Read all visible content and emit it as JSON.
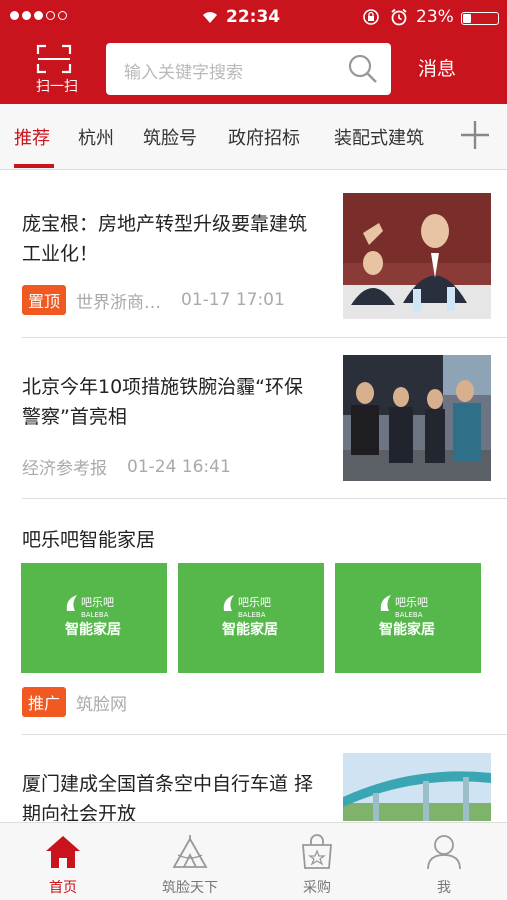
{
  "status_bar": {
    "time": "22:34",
    "battery_text": "23%",
    "battery_level": 0.23
  },
  "header": {
    "scan_label": "扫一扫",
    "search_placeholder": "输入关键字搜索",
    "message_label": "消息"
  },
  "tabs": [
    {
      "label": "推荐",
      "active": true
    },
    {
      "label": "杭州"
    },
    {
      "label": "筑脸号"
    },
    {
      "label": "政府招标"
    },
    {
      "label": "装配式建筑"
    }
  ],
  "feed": [
    {
      "title": "庞宝根：房地产转型升级要靠建筑工业化！",
      "badge": "置顶",
      "source": "世界浙商…",
      "time": "01-17 17:01"
    },
    {
      "title": "北京今年10项措施铁腕治霾“环保警察”首亮相",
      "source": "经济参考报",
      "time": "01-24 16:41"
    },
    {
      "ad_title": "吧乐吧智能家居",
      "tile_logo": "吧乐吧",
      "tile_logo_en": "BALEBA",
      "tile_name": "智能家居",
      "badge": "推广",
      "source": "筑脸网"
    },
    {
      "title": "厦门建成全国首条空中自行车道 择期向社会开放"
    }
  ],
  "bottom_nav": [
    {
      "label": "首页",
      "icon": "home-icon",
      "active": true
    },
    {
      "label": "筑脸天下",
      "icon": "tent-icon"
    },
    {
      "label": "采购",
      "icon": "shopping-bag-icon"
    },
    {
      "label": "我",
      "icon": "user-icon"
    }
  ],
  "colors": {
    "brand_red": "#c9131d",
    "badge_orange": "#f05a22",
    "ad_green": "#56b74b"
  }
}
